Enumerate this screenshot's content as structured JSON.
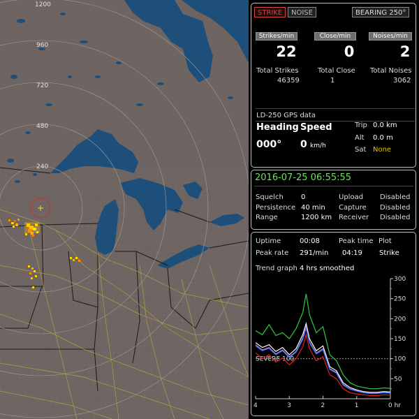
{
  "map": {
    "range_labels": [
      "1200",
      "960",
      "720",
      "480",
      "240"
    ],
    "colors": {
      "land": "#6e6563",
      "water": "#1d4f7a",
      "county_lines": "#8a7f7c",
      "roads": "#b8a640",
      "rings": "#a49c99",
      "strike": "#ffb400"
    }
  },
  "toolbar": {
    "strike_label": "STRIKE",
    "noise_label": "NOISE",
    "bearing_label": "BEARING 250°"
  },
  "rates": {
    "strikes_header": "Strikes/min",
    "strikes_value": "22",
    "close_header": "Close/min",
    "close_value": "0",
    "noises_header": "Noises/min",
    "noises_value": "2"
  },
  "totals": {
    "strikes_label": "Total Strikes",
    "strikes_value": "46359",
    "close_label": "Total Close",
    "close_value": "1",
    "noises_label": "Total Noises",
    "noises_value": "3062"
  },
  "gps": {
    "title": "LD-250 GPS data",
    "heading_label": "Heading",
    "heading_value": "000°",
    "speed_label": "Speed",
    "speed_value": "0",
    "speed_unit": "km/h",
    "trip_label": "Trip",
    "trip_value": "0.0 km",
    "alt_label": "Alt",
    "alt_value": "0.0 m",
    "sat_label": "Sat",
    "sat_value": "None"
  },
  "status": {
    "datetime": "2016-07-25 06:55:55",
    "squelch_label": "Squelch",
    "squelch_value": "0",
    "persistence_label": "Persistence",
    "persistence_value": "40 min",
    "range_label": "Range",
    "range_value": "1200 km",
    "upload_label": "Upload",
    "upload_value": "Disabled",
    "capture_label": "Capture",
    "capture_value": "Disabled",
    "receiver_label": "Receiver",
    "receiver_value": "Disabled"
  },
  "stats": {
    "uptime_label": "Uptime",
    "uptime_value": "00:08",
    "peak_time_label": "Peak time",
    "peak_time_value": "04:19",
    "plot_label": "Plot",
    "plot_value": "Strike",
    "peak_rate_label": "Peak rate",
    "peak_rate_value": "291/min",
    "trend_label": "Trend graph",
    "trend_value": "4 hrs smoothed"
  },
  "chart_data": {
    "type": "line",
    "x_ticks": [
      "4",
      "3",
      "2",
      "1",
      "0 hr"
    ],
    "x_range": [
      4,
      0
    ],
    "y_ticks": [
      "300",
      "250",
      "200",
      "150",
      "100",
      "50"
    ],
    "ylim": [
      0,
      300
    ],
    "severe_label": "SEVERE 100",
    "severe_value": 100,
    "x": [
      4.0,
      3.8,
      3.6,
      3.4,
      3.2,
      3.0,
      2.8,
      2.6,
      2.5,
      2.4,
      2.2,
      2.0,
      1.8,
      1.6,
      1.4,
      1.2,
      1.0,
      0.8,
      0.6,
      0.4,
      0.2,
      0.0
    ],
    "series": [
      {
        "color": "#2ecc40",
        "values": [
          170,
          160,
          185,
          158,
          165,
          150,
          175,
          215,
          262,
          210,
          165,
          180,
          110,
          95,
          60,
          40,
          32,
          28,
          25,
          25,
          27,
          26
        ]
      },
      {
        "color": "#ffffff",
        "values": [
          140,
          128,
          135,
          118,
          128,
          110,
          125,
          160,
          188,
          150,
          120,
          132,
          80,
          70,
          40,
          28,
          22,
          18,
          16,
          16,
          18,
          17
        ]
      },
      {
        "color": "#c47ad8",
        "values": [
          135,
          122,
          128,
          112,
          122,
          105,
          118,
          152,
          180,
          142,
          114,
          125,
          75,
          66,
          36,
          25,
          20,
          16,
          14,
          14,
          16,
          15
        ]
      },
      {
        "color": "#3a7bff",
        "values": [
          132,
          120,
          126,
          110,
          120,
          103,
          116,
          148,
          176,
          140,
          112,
          122,
          73,
          64,
          34,
          24,
          19,
          15,
          13,
          13,
          15,
          14
        ]
      },
      {
        "color": "#e02020",
        "values": [
          115,
          100,
          110,
          92,
          102,
          85,
          100,
          130,
          160,
          125,
          95,
          105,
          60,
          50,
          25,
          15,
          12,
          10,
          8,
          8,
          10,
          9
        ]
      }
    ]
  }
}
